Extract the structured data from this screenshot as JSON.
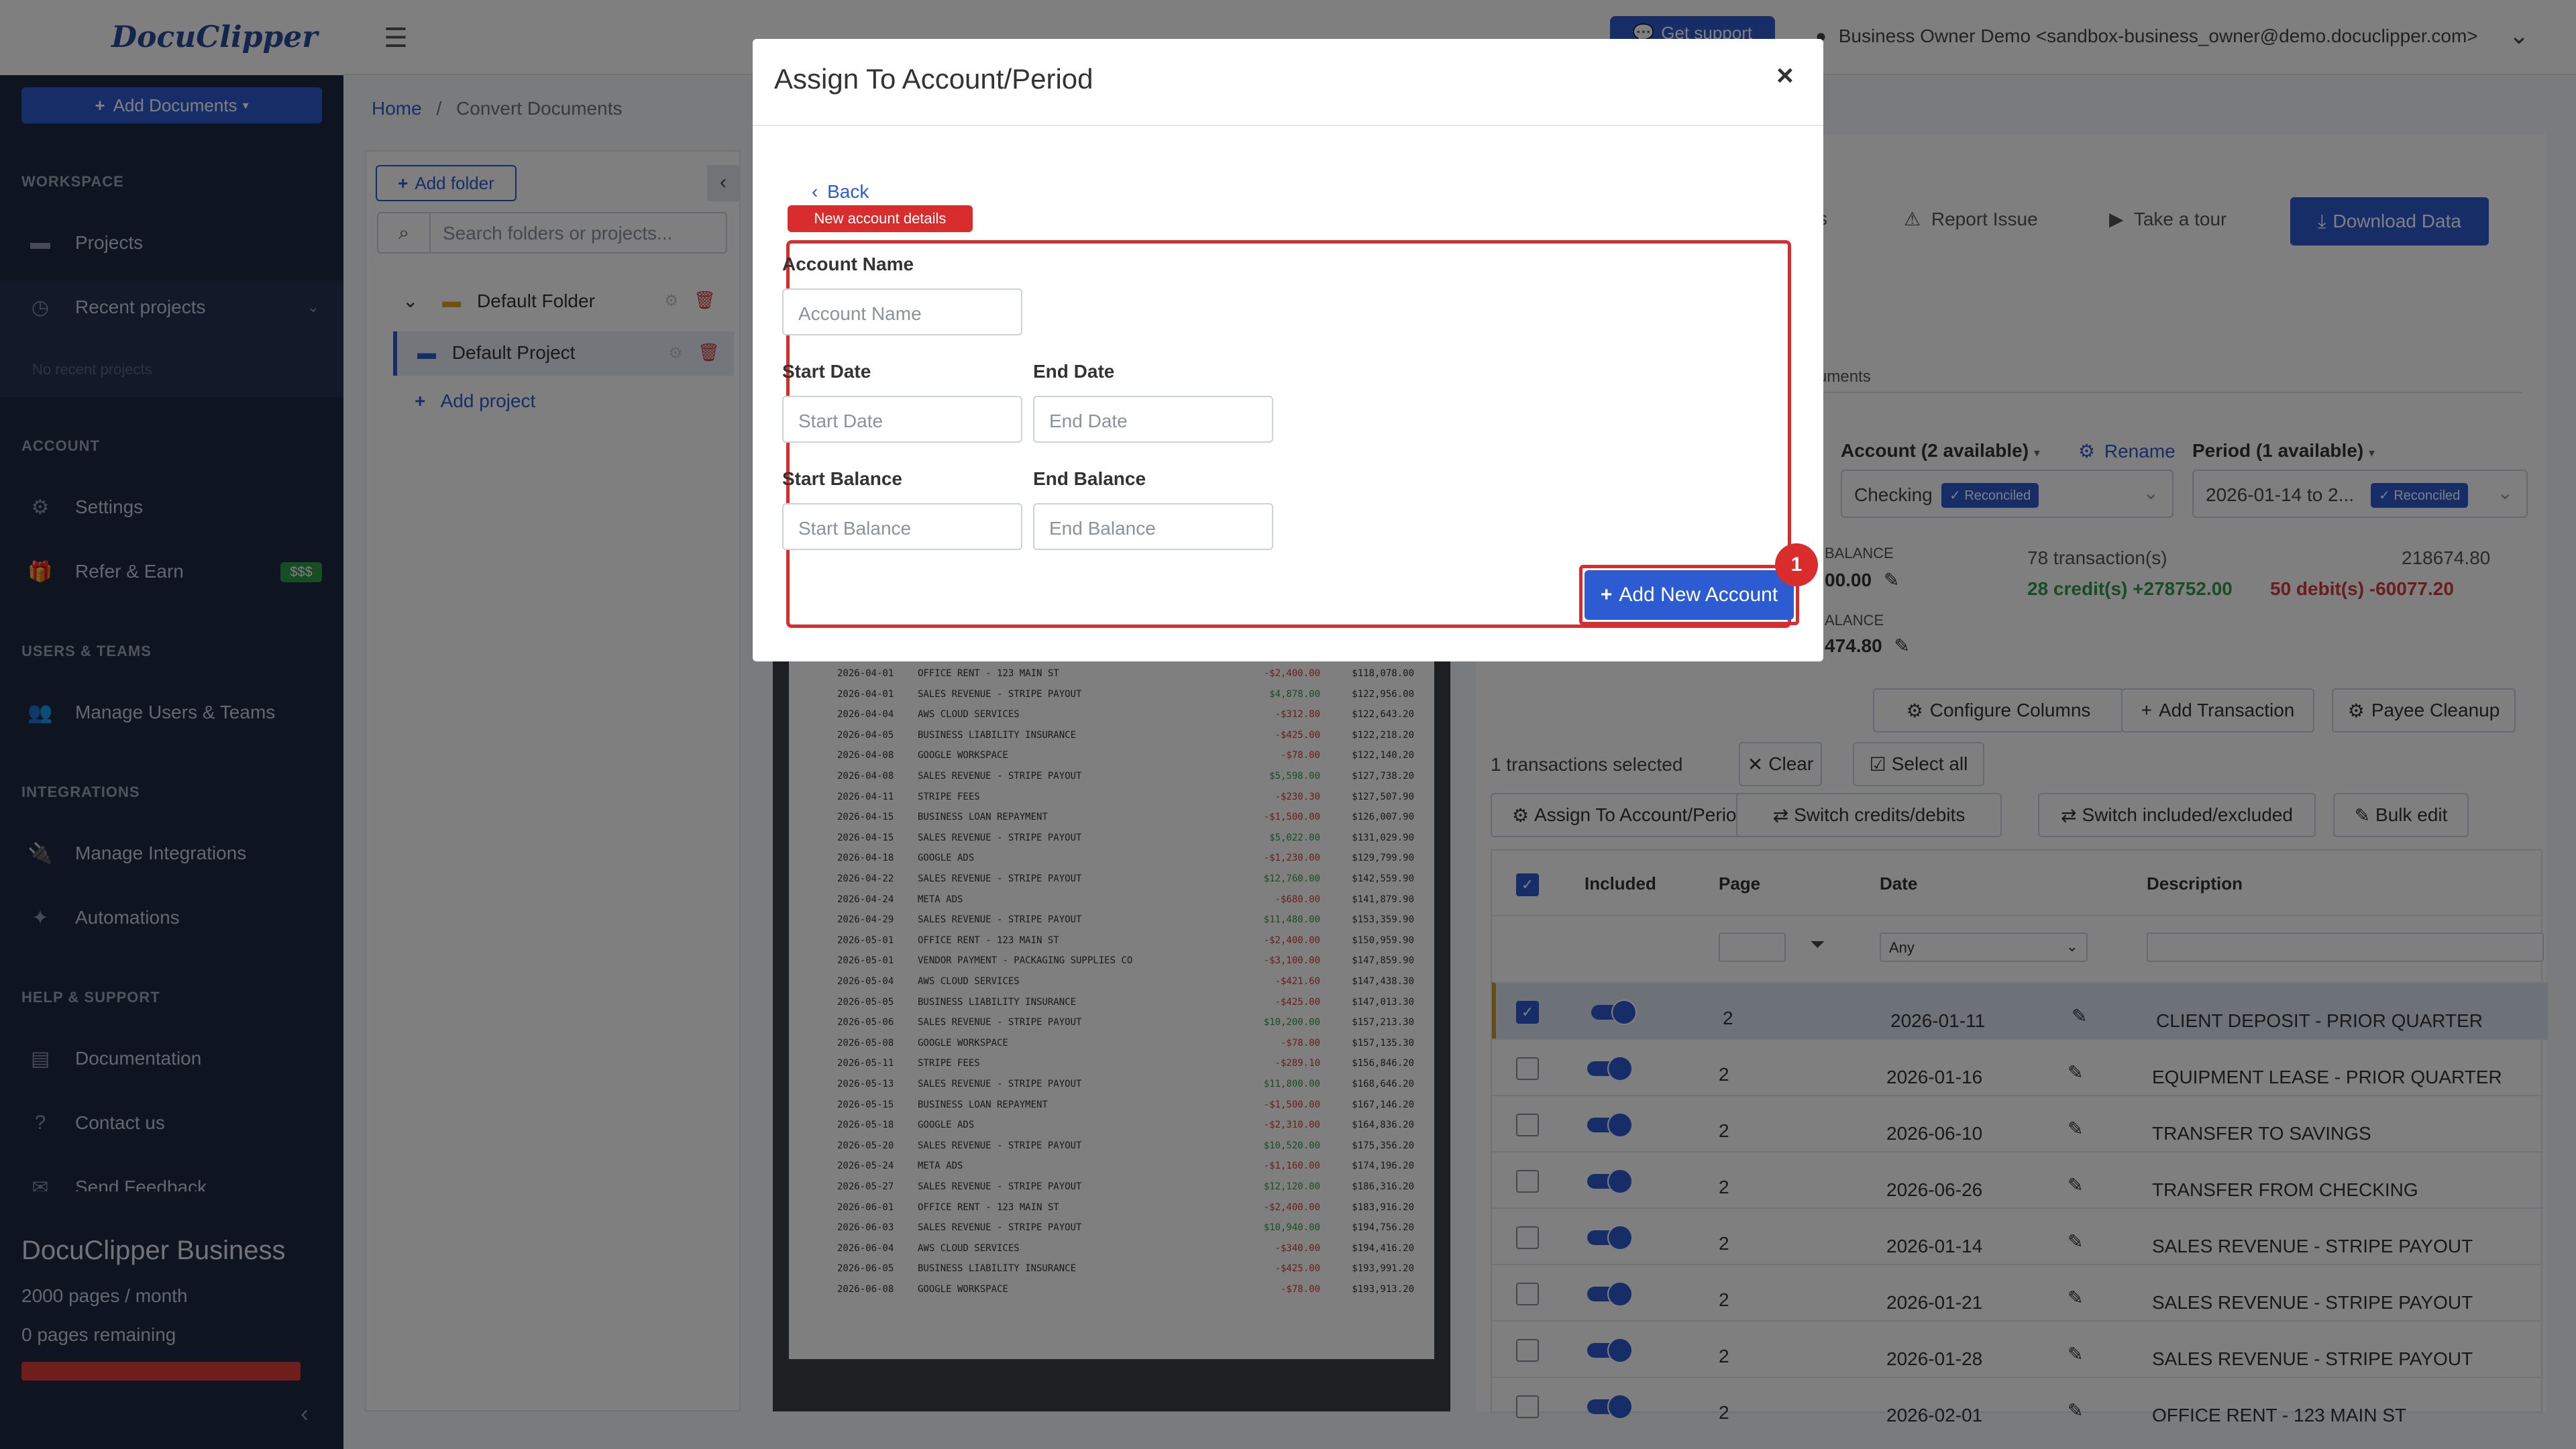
{
  "app": {
    "logo": "DocuClipper",
    "add_documents": "Add Documents"
  },
  "sidebar": {
    "sections": {
      "workspace": "WORKSPACE",
      "account": "ACCOUNT",
      "users_teams": "USERS & TEAMS",
      "integrations": "INTEGRATIONS",
      "help_support": "HELP & SUPPORT"
    },
    "items": {
      "projects": "Projects",
      "recent_projects": "Recent projects",
      "no_recent": "No recent projects",
      "settings": "Settings",
      "refer_earn": "Refer & Earn",
      "refer_badge": "$$$",
      "manage_users": "Manage Users & Teams",
      "manage_integrations": "Manage Integrations",
      "automations": "Automations",
      "documentation": "Documentation",
      "contact_us": "Contact us",
      "send_feedback": "Send Feedback"
    },
    "plan": {
      "name": "DocuClipper Business",
      "pages": "2000 pages / month",
      "remaining": "0 pages remaining"
    }
  },
  "header": {
    "get_support": "Get support",
    "user": "Business Owner Demo <sandbox-business_owner@demo.docuclipper.com>"
  },
  "breadcrumb": {
    "home": "Home",
    "sep": "/",
    "current": "Convert Documents"
  },
  "folders": {
    "add_folder": "Add folder",
    "search_placeholder": "Search folders or projects...",
    "default_folder": "Default Folder",
    "default_project": "Default Project",
    "add_project": "Add project"
  },
  "document": {
    "rows": [
      [
        "2026-04-01",
        "OFFICE RENT - 123 MAIN ST",
        "-$2,400.00",
        "$118,078.00"
      ],
      [
        "2026-04-01",
        "SALES REVENUE - STRIPE PAYOUT",
        "$4,878.00",
        "$122,956.00"
      ],
      [
        "2026-04-04",
        "AWS CLOUD SERVICES",
        "-$312.80",
        "$122,643.20"
      ],
      [
        "2026-04-05",
        "BUSINESS LIABILITY INSURANCE",
        "-$425.00",
        "$122,218.20"
      ],
      [
        "2026-04-08",
        "GOOGLE WORKSPACE",
        "-$78.00",
        "$122,140.20"
      ],
      [
        "2026-04-08",
        "SALES REVENUE - STRIPE PAYOUT",
        "$5,598.00",
        "$127,738.20"
      ],
      [
        "2026-04-11",
        "STRIPE FEES",
        "-$230.30",
        "$127,507.90"
      ],
      [
        "2026-04-15",
        "BUSINESS LOAN REPAYMENT",
        "-$1,500.00",
        "$126,007.90"
      ],
      [
        "2026-04-15",
        "SALES REVENUE - STRIPE PAYOUT",
        "$5,022.00",
        "$131,029.90"
      ],
      [
        "2026-04-18",
        "GOOGLE ADS",
        "-$1,230.00",
        "$129,799.90"
      ],
      [
        "2026-04-22",
        "SALES REVENUE - STRIPE PAYOUT",
        "$12,760.00",
        "$142,559.90"
      ],
      [
        "2026-04-24",
        "META ADS",
        "-$680.00",
        "$141,879.90"
      ],
      [
        "2026-04-29",
        "SALES REVENUE - STRIPE PAYOUT",
        "$11,480.00",
        "$153,359.90"
      ],
      [
        "2026-05-01",
        "OFFICE RENT - 123 MAIN ST",
        "-$2,400.00",
        "$150,959.90"
      ],
      [
        "2026-05-01",
        "VENDOR PAYMENT - PACKAGING SUPPLIES CO",
        "-$3,100.00",
        "$147,859.90"
      ],
      [
        "2026-05-04",
        "AWS CLOUD SERVICES",
        "-$421.60",
        "$147,438.30"
      ],
      [
        "2026-05-05",
        "BUSINESS LIABILITY INSURANCE",
        "-$425.00",
        "$147,013.30"
      ],
      [
        "2026-05-06",
        "SALES REVENUE - STRIPE PAYOUT",
        "$10,200.00",
        "$157,213.30"
      ],
      [
        "2026-05-08",
        "GOOGLE WORKSPACE",
        "-$78.00",
        "$157,135.30"
      ],
      [
        "2026-05-11",
        "STRIPE FEES",
        "-$289.10",
        "$156,846.20"
      ],
      [
        "2026-05-13",
        "SALES REVENUE - STRIPE PAYOUT",
        "$11,800.00",
        "$168,646.20"
      ],
      [
        "2026-05-15",
        "BUSINESS LOAN REPAYMENT",
        "-$1,500.00",
        "$167,146.20"
      ],
      [
        "2026-05-18",
        "GOOGLE ADS",
        "-$2,310.00",
        "$164,836.20"
      ],
      [
        "2026-05-20",
        "SALES REVENUE - STRIPE PAYOUT",
        "$10,520.00",
        "$175,356.20"
      ],
      [
        "2026-05-24",
        "META ADS",
        "-$1,160.00",
        "$174,196.20"
      ],
      [
        "2026-05-27",
        "SALES REVENUE - STRIPE PAYOUT",
        "$12,120.00",
        "$186,316.20"
      ],
      [
        "2026-06-01",
        "OFFICE RENT - 123 MAIN ST",
        "-$2,400.00",
        "$183,916.20"
      ],
      [
        "2026-06-03",
        "SALES REVENUE - STRIPE PAYOUT",
        "$10,940.00",
        "$194,756.20"
      ],
      [
        "2026-06-04",
        "AWS CLOUD SERVICES",
        "-$340.00",
        "$194,416.20"
      ],
      [
        "2026-06-05",
        "BUSINESS LIABILITY INSURANCE",
        "-$425.00",
        "$193,991.20"
      ],
      [
        "2026-06-08",
        "GOOGLE WORKSPACE",
        "-$78.00",
        "$193,913.20"
      ]
    ]
  },
  "toolbar": {
    "s_fragment": "s",
    "report_issue": "Report Issue",
    "take_tour": "Take a tour",
    "download_data": "Download Data",
    "documents_tab": "uments"
  },
  "account_panel": {
    "account_label": "Account (2 available)",
    "rename": "Rename",
    "period_label": "Period (1 available)",
    "account_value": "Checking",
    "reconciled": "Reconciled",
    "period_value": "2026-01-14 to 2...",
    "start_balance_label": "BALANCE",
    "start_balance_value": "00.00",
    "end_balance_label": "ALANCE",
    "end_balance_value": "474.80",
    "transactions": "78 transaction(s)",
    "total": "218674.80",
    "credits": "28 credit(s) +278752.00",
    "debits": "50 debit(s) -60077.20"
  },
  "actions": {
    "configure_columns": "Configure Columns",
    "add_transaction": "Add Transaction",
    "payee_cleanup": "Payee Cleanup",
    "selected_count": "1 transactions selected",
    "clear": "Clear",
    "select_all": "Select all",
    "assign": "Assign To Account/Period",
    "switch_cd": "Switch credits/debits",
    "switch_ie": "Switch included/excluded",
    "bulk_edit": "Bulk edit"
  },
  "table": {
    "headers": {
      "included": "Included",
      "page": "Page",
      "date": "Date",
      "description": "Description"
    },
    "date_filter": "Any",
    "rows": [
      {
        "page": "2",
        "date": "2026-01-11",
        "description": "CLIENT DEPOSIT - PRIOR QUARTER",
        "selected": true
      },
      {
        "page": "2",
        "date": "2026-01-16",
        "description": "EQUIPMENT LEASE - PRIOR QUARTER",
        "selected": false
      },
      {
        "page": "2",
        "date": "2026-06-10",
        "description": "TRANSFER TO SAVINGS",
        "selected": false
      },
      {
        "page": "2",
        "date": "2026-06-26",
        "description": "TRANSFER FROM CHECKING",
        "selected": false
      },
      {
        "page": "2",
        "date": "2026-01-14",
        "description": "SALES REVENUE - STRIPE PAYOUT",
        "selected": false
      },
      {
        "page": "2",
        "date": "2026-01-21",
        "description": "SALES REVENUE - STRIPE PAYOUT",
        "selected": false
      },
      {
        "page": "2",
        "date": "2026-01-28",
        "description": "SALES REVENUE - STRIPE PAYOUT",
        "selected": false
      },
      {
        "page": "2",
        "date": "2026-02-01",
        "description": "OFFICE RENT - 123 MAIN ST",
        "selected": false
      }
    ]
  },
  "modal": {
    "title": "Assign To Account/Period",
    "close": "×",
    "back": "Back",
    "badge": "New account details",
    "account_name_label": "Account Name",
    "account_name_placeholder": "Account Name",
    "start_date_label": "Start Date",
    "start_date_placeholder": "Start Date",
    "end_date_label": "End Date",
    "end_date_placeholder": "End Date",
    "start_balance_label": "Start Balance",
    "start_balance_placeholder": "Start Balance",
    "end_balance_label": "End Balance",
    "end_balance_placeholder": "End Balance",
    "add_new_account": "Add New Account",
    "step": "1"
  },
  "colors": {
    "primary": "#2d5bd1",
    "sidebar": "#1e2842",
    "highlight": "#d92c2c",
    "credit": "#2e9b4a",
    "debit": "#d23b3b"
  }
}
